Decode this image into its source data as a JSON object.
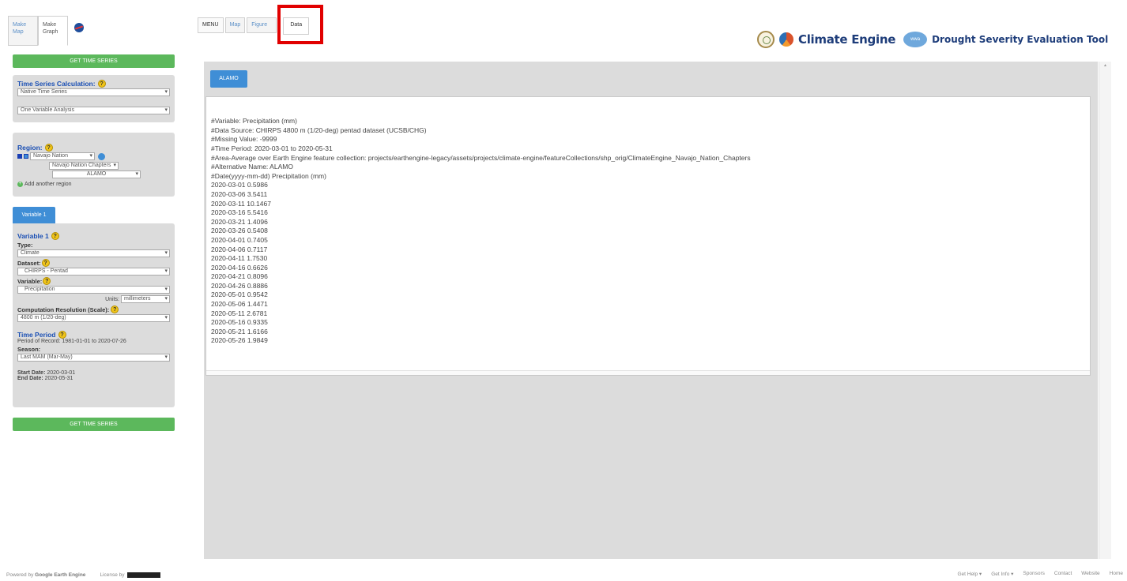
{
  "left_tabs": [
    {
      "label": "Make Map"
    },
    {
      "label": "Make Graph"
    }
  ],
  "get_time_series_label": "GET TIME SERIES",
  "calc": {
    "title": "Time Series Calculation:",
    "select1": "Native Time Series",
    "select2": "One Variable Analysis"
  },
  "region": {
    "title": "Region:",
    "region_select": "Navajo Nation",
    "chapters_select": "Navajo Nation Chapters",
    "feature_select": "ALAMO",
    "add_label": "Add another region"
  },
  "variable_tab": "Variable 1",
  "variable": {
    "title": "Variable 1",
    "type_label": "Type:",
    "type_value": "Climate",
    "dataset_label": "Dataset:",
    "dataset_value": "CHIRPS - Pentad",
    "variable_label": "Variable:",
    "variable_value": "Precipitation",
    "units_label": "Units:",
    "units_value": "millimeters",
    "resolution_label": "Computation Resolution (Scale):",
    "resolution_value": "4800 m (1/20-deg)"
  },
  "time_period": {
    "title": "Time Period",
    "record": "Period of Record: 1981-01-01 to 2020-07-26",
    "season_label": "Season:",
    "season_value": "Last MAM (Mar-May)",
    "start_label": "Start Date:",
    "start_value": "2020-03-01",
    "end_label": "End Date:",
    "end_value": "2020-05-31"
  },
  "top_tabs": {
    "menu": "MENU",
    "map": "Map",
    "figure": "Figure",
    "data": "Data"
  },
  "brand": {
    "climate_engine": "Climate Engine",
    "wwa": "wwa",
    "tool": "Drought Severity Evaluation Tool"
  },
  "feature_button": "ALAMO",
  "data_lines": [
    "#Variable: Precipitation (mm)",
    "#Data Source: CHIRPS 4800 m (1/20-deg) pentad dataset (UCSB/CHG)",
    "#Missing Value: -9999",
    "#Time Period: 2020-03-01 to 2020-05-31",
    "#Area-Average over Earth Engine feature collection: projects/earthengine-legacy/assets/projects/climate-engine/featureCollections/shp_orig/ClimateEngine_Navajo_Nation_Chapters",
    "#Alternative Name: ALAMO",
    "#Date(yyyy-mm-dd) Precipitation (mm)",
    "2020-03-01 0.5986",
    "2020-03-06 3.5411",
    "2020-03-11 10.1467",
    "2020-03-16 5.5416",
    "2020-03-21 1.4096",
    "2020-03-26 0.5408",
    "2020-04-01 0.7405",
    "2020-04-06 0.7117",
    "2020-04-11 1.7530",
    "2020-04-16 0.6626",
    "2020-04-21 0.8096",
    "2020-04-26 0.8886",
    "2020-05-01 0.9542",
    "2020-05-06 1.4471",
    "2020-05-11 2.6781",
    "2020-05-16 0.9335",
    "2020-05-21 1.6166",
    "2020-05-26 1.9849"
  ],
  "footer": {
    "powered": "Powered by",
    "gee": "Google Earth Engine",
    "license": "License by",
    "links": [
      "Get Help",
      "Get Info",
      "Sponsors",
      "Contact",
      "Website",
      "Home"
    ]
  },
  "colors": {
    "accent_blue": "#3f8ed6",
    "green": "#5cb85c",
    "highlight_red": "#e10000",
    "panel_gray": "#dcdcdc"
  }
}
